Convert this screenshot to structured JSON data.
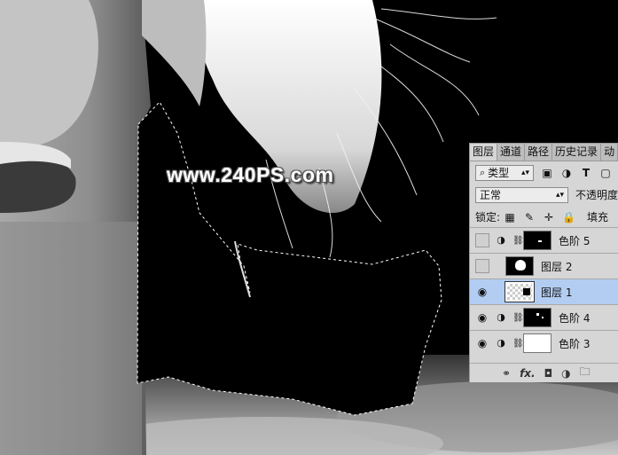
{
  "watermark": "www.240PS.com",
  "panel": {
    "tabs": [
      "图层",
      "通道",
      "路径",
      "历史记录",
      "动"
    ],
    "filter_kind": "类型",
    "blend_mode": "正常",
    "opacity_label": "不透明度",
    "lock_label": "锁定:",
    "fill_label": "填充",
    "layers": [
      {
        "name": "色阶 5",
        "visible": false,
        "type": "adjustment",
        "selected": false
      },
      {
        "name": "图层 2",
        "visible": false,
        "type": "pixel",
        "selected": false
      },
      {
        "name": "图层 1",
        "visible": true,
        "type": "pixel",
        "selected": true
      },
      {
        "name": "色阶 4",
        "visible": true,
        "type": "adjustment",
        "selected": false
      },
      {
        "name": "色阶 3",
        "visible": true,
        "type": "adjustment",
        "selected": false
      }
    ]
  },
  "icons": {
    "visibility": "eye-icon",
    "adjustment": "half-circle-icon",
    "link": "chain-icon",
    "search": "search-icon"
  },
  "colors": {
    "selected_layer": "#b3cdf2",
    "panel_bg": "#d6d6d6"
  }
}
